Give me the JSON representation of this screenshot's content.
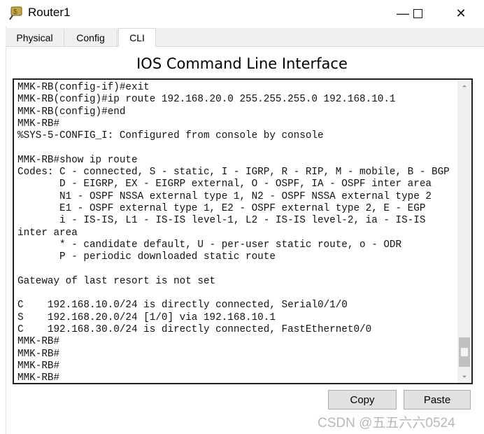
{
  "window": {
    "title": "Router1",
    "minimize_icon": "minimize-icon",
    "maximize_icon": "maximize-icon",
    "close_icon": "close-icon"
  },
  "tabs": [
    {
      "label": "Physical"
    },
    {
      "label": "Config"
    },
    {
      "label": "CLI",
      "active": true
    }
  ],
  "heading": "IOS Command Line Interface",
  "terminal": {
    "lines": [
      "MMK-RB(config-if)#exit",
      "MMK-RB(config)#ip route 192.168.20.0 255.255.255.0 192.168.10.1",
      "MMK-RB(config)#end",
      "MMK-RB#",
      "%SYS-5-CONFIG_I: Configured from console by console",
      "",
      "MMK-RB#show ip route",
      "Codes: C - connected, S - static, I - IGRP, R - RIP, M - mobile, B - BGP",
      "       D - EIGRP, EX - EIGRP external, O - OSPF, IA - OSPF inter area",
      "       N1 - OSPF NSSA external type 1, N2 - OSPF NSSA external type 2",
      "       E1 - OSPF external type 1, E2 - OSPF external type 2, E - EGP",
      "       i - IS-IS, L1 - IS-IS level-1, L2 - IS-IS level-2, ia - IS-IS",
      "inter area",
      "       * - candidate default, U - per-user static route, o - ODR",
      "       P - periodic downloaded static route",
      "",
      "Gateway of last resort is not set",
      "",
      "C    192.168.10.0/24 is directly connected, Serial0/1/0",
      "S    192.168.20.0/24 [1/0] via 192.168.10.1",
      "C    192.168.30.0/24 is directly connected, FastEthernet0/0",
      "MMK-RB#",
      "MMK-RB#",
      "MMK-RB#",
      "MMK-RB#"
    ],
    "scroll_position": 0.95
  },
  "buttons": {
    "copy": "Copy",
    "paste": "Paste"
  },
  "watermark": "CSDN @五五六六0524"
}
